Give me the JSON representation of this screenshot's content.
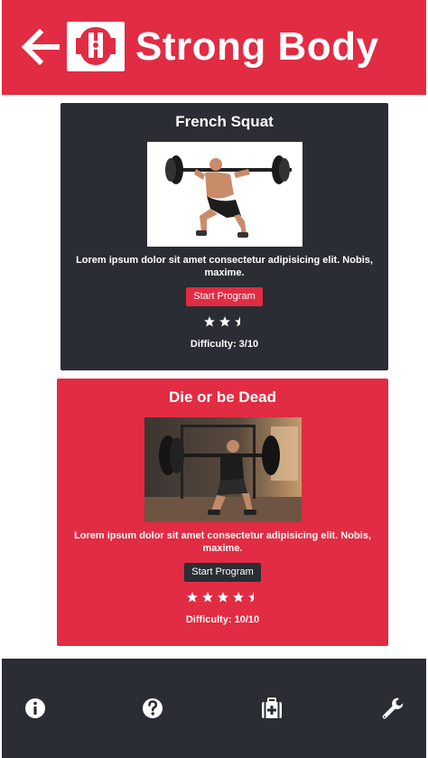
{
  "header": {
    "title": "Strong Body",
    "back_icon": "arrow-left-icon",
    "logo_icon": "strong-body-logo"
  },
  "programs": [
    {
      "title": "French Squat",
      "description": "Lorem ipsum dolor sit amet consectetur adipisicing elit. Nobis, maxime.",
      "button_label": "Start Program",
      "rating": 2.5,
      "difficulty": "Difficulty: 3/10",
      "theme": "dark"
    },
    {
      "title": "Die or be Dead",
      "description": "Lorem ipsum dolor sit amet consectetur adipisicing elit. Nobis, maxime.",
      "button_label": "Start Program",
      "rating": 4.5,
      "difficulty": "Difficulty: 10/10",
      "theme": "red"
    }
  ],
  "nav": {
    "items": [
      {
        "icon": "info-icon"
      },
      {
        "icon": "help-icon"
      },
      {
        "icon": "medical-kit-icon"
      },
      {
        "icon": "wrench-icon"
      }
    ]
  },
  "colors": {
    "brand_red": "#e12c43",
    "dark": "#2a2d33",
    "white": "#ffffff"
  }
}
